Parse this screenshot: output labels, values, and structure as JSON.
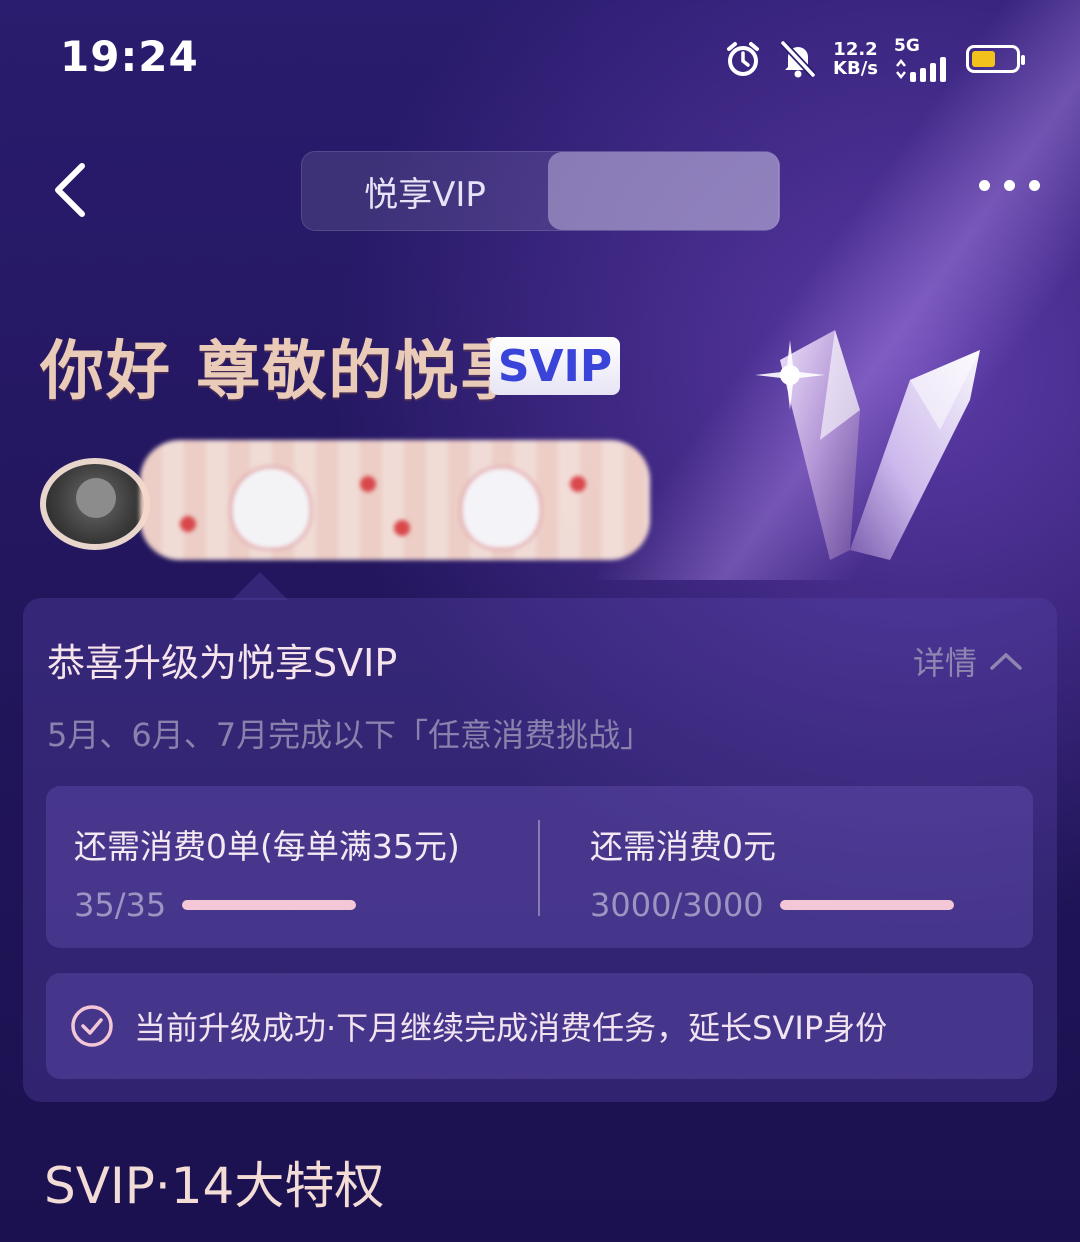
{
  "status_bar": {
    "time": "19:24",
    "speed_value": "12.2",
    "speed_unit": "KB/s",
    "network": "5G",
    "battery_level": 0.55,
    "battery_color": "#f3c11c"
  },
  "header": {
    "tab_active": "悦享VIP",
    "tab_other": ""
  },
  "hero": {
    "greeting": "你好 尊敬的悦享",
    "badge": "SVIP"
  },
  "card": {
    "title": "恭喜升级为悦享SVIP",
    "details_label": "详情",
    "subtitle": "5月、6月、7月完成以下「任意消费挑战」",
    "progress": [
      {
        "label": "还需消费0单(每单满35元)",
        "count": "35/35",
        "fraction": 1.0
      },
      {
        "label": "还需消费0元",
        "count": "3000/3000",
        "fraction": 1.0
      }
    ],
    "status_text": "当前升级成功·下月继续完成消费任务，延长SVIP身份"
  },
  "section": {
    "title": "SVIP·14大特权"
  },
  "colors": {
    "accent_pink": "#f3c7d6",
    "badge_blue": "#3a44d8",
    "background": "#241760"
  }
}
